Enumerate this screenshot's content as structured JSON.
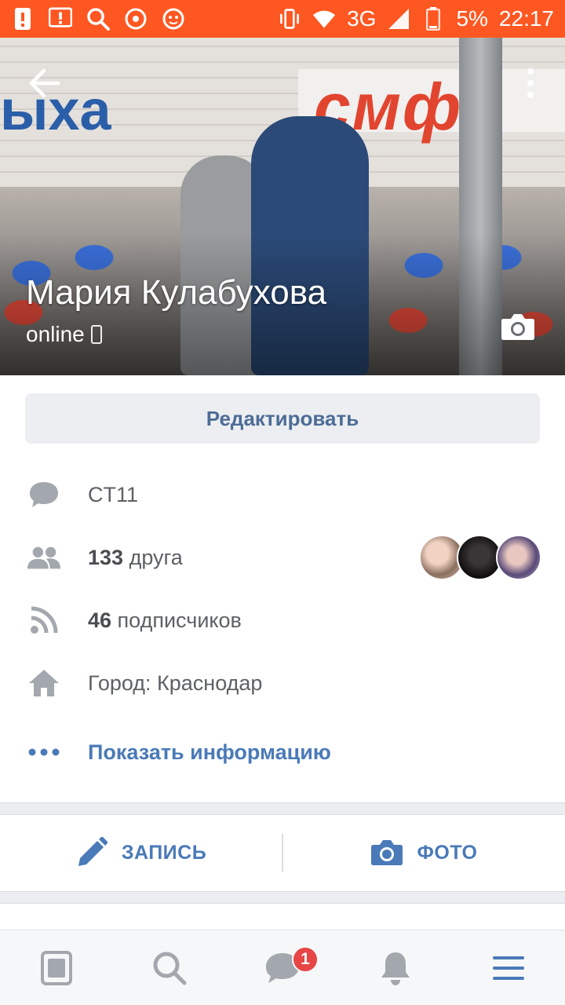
{
  "status_bar": {
    "network": "3G",
    "battery": "5%",
    "time": "22:17"
  },
  "cover": {
    "bg_text_left": "ыха",
    "bg_text_right": "смф"
  },
  "profile": {
    "name": "Мария Кулабухова",
    "status": "online"
  },
  "actions": {
    "edit_label": "Редактировать"
  },
  "info": {
    "status_text": "CT11",
    "friends_count": "133",
    "friends_word": " друга",
    "followers_count": "46",
    "followers_word": " подписчиков",
    "city": "Город: Краснодар",
    "show_info": "Показать информацию"
  },
  "post_bar": {
    "post_label": "ЗАПИСЬ",
    "photo_label": "ФОТО"
  },
  "bottom_nav": {
    "messages_badge": "1"
  },
  "colors": {
    "status_bar": "#ff5722",
    "accent": "#4a7ab8",
    "icon_gray": "#a3a8ae",
    "badge": "#e64646"
  }
}
